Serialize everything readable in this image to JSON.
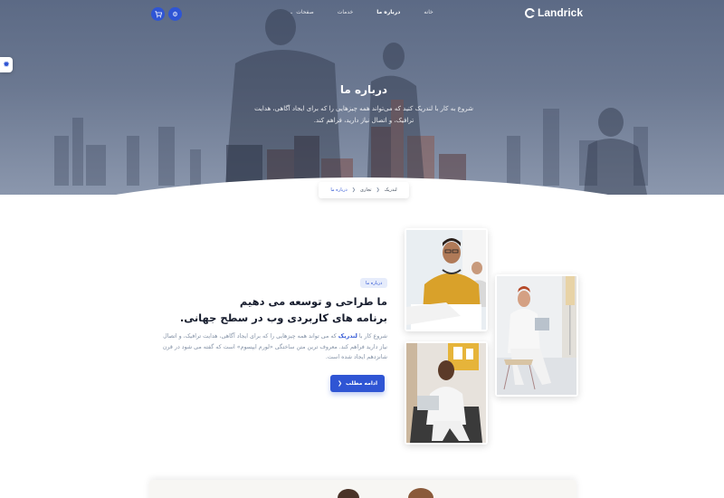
{
  "brand": {
    "name": "Landrick"
  },
  "nav": {
    "items": [
      {
        "label": "خانه"
      },
      {
        "label": "درباره ما"
      },
      {
        "label": "خدمات"
      },
      {
        "label": "صفحات"
      }
    ],
    "active_index": 1,
    "icons": [
      "settings-icon",
      "cart-icon"
    ]
  },
  "hero": {
    "title": "درباره ما",
    "subtitle": "شروع به کار با لندریک کنید که می‌تواند همه چیزهایی را که برای ایجاد آگاهی، هدایت ترافیک، و اتصال نیاز دارید، فراهم کند."
  },
  "breadcrumb": [
    {
      "label": "لندریک"
    },
    {
      "label": "تجاری"
    },
    {
      "label": "درباره ما"
    }
  ],
  "about": {
    "badge": "درباره ما",
    "title_line1": "ما طراحی و توسعه می دهیم",
    "title_line2": "برنامه های کاربردی وب در سطح جهانی.",
    "text_before": "شروع کار با ",
    "text_brand": "لندریک",
    "text_after": " که می تواند همه چیزهایی را که برای ایجاد آگاهی، هدایت ترافیک، و اتصال نیاز دارید فراهم کند. معروف ترین متن ساختگی «لورم ایپسوم» است که گفته می شود در قرن شانزدهم ایجاد شده است.",
    "button_label": "ادامه مطلب",
    "button_icon": "chevron-left-icon"
  },
  "colors": {
    "primary": "#2f55d4",
    "hero_overlay": "#6b7891",
    "heading": "#161c2d",
    "muted": "#8492a6"
  }
}
